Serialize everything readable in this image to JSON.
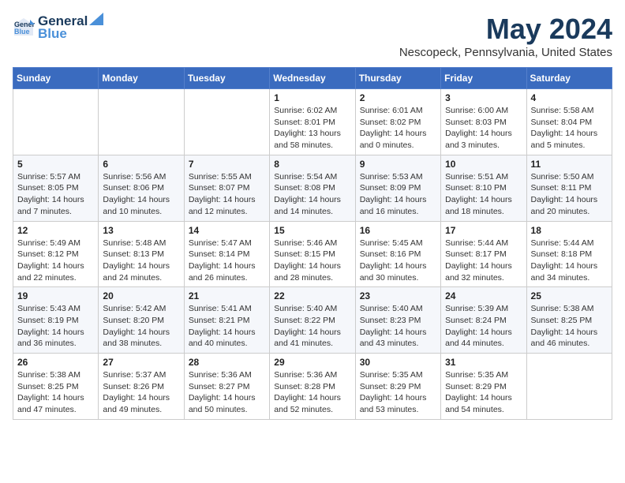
{
  "logo": {
    "line1": "General",
    "line2": "Blue"
  },
  "title": "May 2024",
  "location": "Nescopeck, Pennsylvania, United States",
  "days_header": [
    "Sunday",
    "Monday",
    "Tuesday",
    "Wednesday",
    "Thursday",
    "Friday",
    "Saturday"
  ],
  "weeks": [
    [
      {
        "day": "",
        "sunrise": "",
        "sunset": "",
        "daylight": ""
      },
      {
        "day": "",
        "sunrise": "",
        "sunset": "",
        "daylight": ""
      },
      {
        "day": "",
        "sunrise": "",
        "sunset": "",
        "daylight": ""
      },
      {
        "day": "1",
        "sunrise": "Sunrise: 6:02 AM",
        "sunset": "Sunset: 8:01 PM",
        "daylight": "Daylight: 13 hours and 58 minutes."
      },
      {
        "day": "2",
        "sunrise": "Sunrise: 6:01 AM",
        "sunset": "Sunset: 8:02 PM",
        "daylight": "Daylight: 14 hours and 0 minutes."
      },
      {
        "day": "3",
        "sunrise": "Sunrise: 6:00 AM",
        "sunset": "Sunset: 8:03 PM",
        "daylight": "Daylight: 14 hours and 3 minutes."
      },
      {
        "day": "4",
        "sunrise": "Sunrise: 5:58 AM",
        "sunset": "Sunset: 8:04 PM",
        "daylight": "Daylight: 14 hours and 5 minutes."
      }
    ],
    [
      {
        "day": "5",
        "sunrise": "Sunrise: 5:57 AM",
        "sunset": "Sunset: 8:05 PM",
        "daylight": "Daylight: 14 hours and 7 minutes."
      },
      {
        "day": "6",
        "sunrise": "Sunrise: 5:56 AM",
        "sunset": "Sunset: 8:06 PM",
        "daylight": "Daylight: 14 hours and 10 minutes."
      },
      {
        "day": "7",
        "sunrise": "Sunrise: 5:55 AM",
        "sunset": "Sunset: 8:07 PM",
        "daylight": "Daylight: 14 hours and 12 minutes."
      },
      {
        "day": "8",
        "sunrise": "Sunrise: 5:54 AM",
        "sunset": "Sunset: 8:08 PM",
        "daylight": "Daylight: 14 hours and 14 minutes."
      },
      {
        "day": "9",
        "sunrise": "Sunrise: 5:53 AM",
        "sunset": "Sunset: 8:09 PM",
        "daylight": "Daylight: 14 hours and 16 minutes."
      },
      {
        "day": "10",
        "sunrise": "Sunrise: 5:51 AM",
        "sunset": "Sunset: 8:10 PM",
        "daylight": "Daylight: 14 hours and 18 minutes."
      },
      {
        "day": "11",
        "sunrise": "Sunrise: 5:50 AM",
        "sunset": "Sunset: 8:11 PM",
        "daylight": "Daylight: 14 hours and 20 minutes."
      }
    ],
    [
      {
        "day": "12",
        "sunrise": "Sunrise: 5:49 AM",
        "sunset": "Sunset: 8:12 PM",
        "daylight": "Daylight: 14 hours and 22 minutes."
      },
      {
        "day": "13",
        "sunrise": "Sunrise: 5:48 AM",
        "sunset": "Sunset: 8:13 PM",
        "daylight": "Daylight: 14 hours and 24 minutes."
      },
      {
        "day": "14",
        "sunrise": "Sunrise: 5:47 AM",
        "sunset": "Sunset: 8:14 PM",
        "daylight": "Daylight: 14 hours and 26 minutes."
      },
      {
        "day": "15",
        "sunrise": "Sunrise: 5:46 AM",
        "sunset": "Sunset: 8:15 PM",
        "daylight": "Daylight: 14 hours and 28 minutes."
      },
      {
        "day": "16",
        "sunrise": "Sunrise: 5:45 AM",
        "sunset": "Sunset: 8:16 PM",
        "daylight": "Daylight: 14 hours and 30 minutes."
      },
      {
        "day": "17",
        "sunrise": "Sunrise: 5:44 AM",
        "sunset": "Sunset: 8:17 PM",
        "daylight": "Daylight: 14 hours and 32 minutes."
      },
      {
        "day": "18",
        "sunrise": "Sunrise: 5:44 AM",
        "sunset": "Sunset: 8:18 PM",
        "daylight": "Daylight: 14 hours and 34 minutes."
      }
    ],
    [
      {
        "day": "19",
        "sunrise": "Sunrise: 5:43 AM",
        "sunset": "Sunset: 8:19 PM",
        "daylight": "Daylight: 14 hours and 36 minutes."
      },
      {
        "day": "20",
        "sunrise": "Sunrise: 5:42 AM",
        "sunset": "Sunset: 8:20 PM",
        "daylight": "Daylight: 14 hours and 38 minutes."
      },
      {
        "day": "21",
        "sunrise": "Sunrise: 5:41 AM",
        "sunset": "Sunset: 8:21 PM",
        "daylight": "Daylight: 14 hours and 40 minutes."
      },
      {
        "day": "22",
        "sunrise": "Sunrise: 5:40 AM",
        "sunset": "Sunset: 8:22 PM",
        "daylight": "Daylight: 14 hours and 41 minutes."
      },
      {
        "day": "23",
        "sunrise": "Sunrise: 5:40 AM",
        "sunset": "Sunset: 8:23 PM",
        "daylight": "Daylight: 14 hours and 43 minutes."
      },
      {
        "day": "24",
        "sunrise": "Sunrise: 5:39 AM",
        "sunset": "Sunset: 8:24 PM",
        "daylight": "Daylight: 14 hours and 44 minutes."
      },
      {
        "day": "25",
        "sunrise": "Sunrise: 5:38 AM",
        "sunset": "Sunset: 8:25 PM",
        "daylight": "Daylight: 14 hours and 46 minutes."
      }
    ],
    [
      {
        "day": "26",
        "sunrise": "Sunrise: 5:38 AM",
        "sunset": "Sunset: 8:25 PM",
        "daylight": "Daylight: 14 hours and 47 minutes."
      },
      {
        "day": "27",
        "sunrise": "Sunrise: 5:37 AM",
        "sunset": "Sunset: 8:26 PM",
        "daylight": "Daylight: 14 hours and 49 minutes."
      },
      {
        "day": "28",
        "sunrise": "Sunrise: 5:36 AM",
        "sunset": "Sunset: 8:27 PM",
        "daylight": "Daylight: 14 hours and 50 minutes."
      },
      {
        "day": "29",
        "sunrise": "Sunrise: 5:36 AM",
        "sunset": "Sunset: 8:28 PM",
        "daylight": "Daylight: 14 hours and 52 minutes."
      },
      {
        "day": "30",
        "sunrise": "Sunrise: 5:35 AM",
        "sunset": "Sunset: 8:29 PM",
        "daylight": "Daylight: 14 hours and 53 minutes."
      },
      {
        "day": "31",
        "sunrise": "Sunrise: 5:35 AM",
        "sunset": "Sunset: 8:29 PM",
        "daylight": "Daylight: 14 hours and 54 minutes."
      },
      {
        "day": "",
        "sunrise": "",
        "sunset": "",
        "daylight": ""
      }
    ]
  ]
}
